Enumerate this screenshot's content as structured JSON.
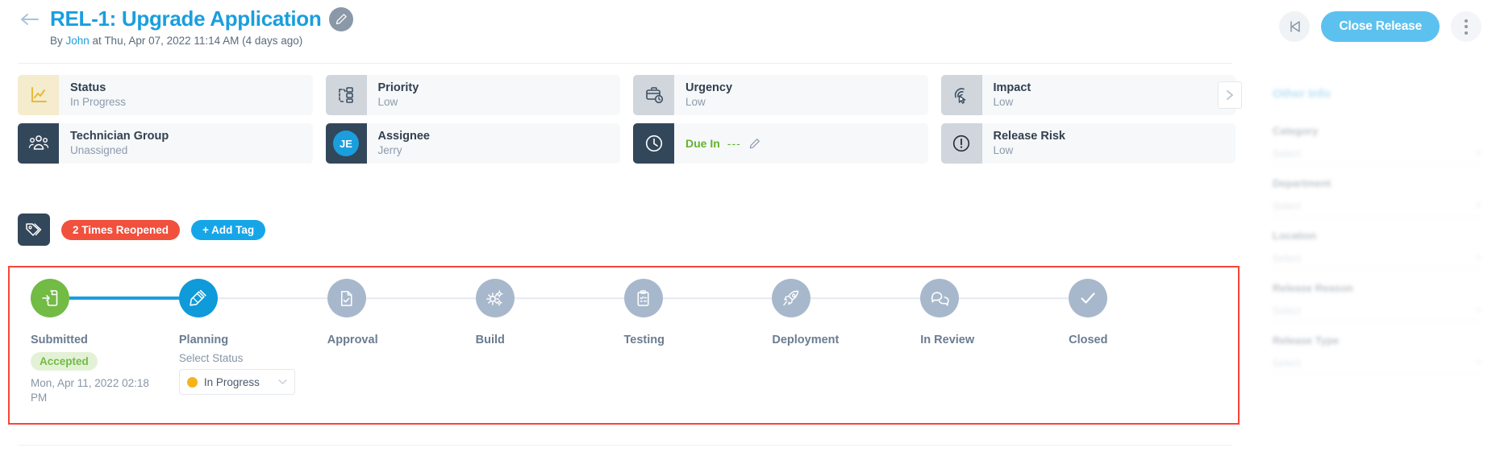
{
  "header": {
    "back_icon": "arrow-left-icon",
    "title": "REL-1: Upgrade Application",
    "edit_icon": "pencil-icon",
    "subtitle_prefix": "By ",
    "subtitle_author": "John",
    "subtitle_rest": " at Thu, Apr 07, 2022 11:14 AM (4 days ago)",
    "prev_icon": "skip-back-icon",
    "close_release_label": "Close Release",
    "more_icon": "kebab-menu-icon",
    "accent_blue": "#16a6e8"
  },
  "cards": {
    "next_icon": "chevron-right-icon",
    "row1": [
      {
        "label": "Status",
        "value": "In Progress",
        "icon": "line-chart-icon",
        "icon_bg": "yellow"
      },
      {
        "label": "Priority",
        "value": "Low",
        "icon": "priority-flow-icon",
        "icon_bg": "grey"
      },
      {
        "label": "Urgency",
        "value": "Low",
        "icon": "briefcase-clock-icon",
        "icon_bg": "grey"
      },
      {
        "label": "Impact",
        "value": "Low",
        "icon": "impact-target-icon",
        "icon_bg": "grey"
      }
    ],
    "row2": [
      {
        "label": "Technician Group",
        "value": "Unassigned",
        "icon": "people-group-icon",
        "icon_bg": "dark"
      },
      {
        "label": "Assignee",
        "value": "Jerry",
        "icon": "avatar-initials",
        "icon_bg": "dark",
        "initials": "JE"
      },
      {
        "label": "Due In",
        "value": "---",
        "icon": "clock-icon",
        "icon_bg": "dark",
        "edit_icon": "pencil-icon",
        "value_color": "#62b32e"
      },
      {
        "label": "Release Risk",
        "value": "Low",
        "icon": "alert-circle-icon",
        "icon_bg": "grey"
      }
    ]
  },
  "tags": {
    "tag_icon": "tags-icon",
    "items": [
      {
        "label": "2 Times Reopened",
        "color": "#f1503c"
      }
    ],
    "add_tag_label": "+ Add Tag"
  },
  "workflow": {
    "steps": [
      {
        "name": "Submitted",
        "icon": "file-import-icon",
        "state": "done",
        "badge": "Accepted",
        "date": "Mon, Apr 11, 2022 02:18 PM"
      },
      {
        "name": "Planning",
        "icon": "plan-edit-icon",
        "state": "current",
        "select_label": "Select Status",
        "select_value": "In Progress",
        "select_dot_color": "#f5b31c",
        "chevron": "chevron-down-icon"
      },
      {
        "name": "Approval",
        "icon": "file-check-icon",
        "state": "pending"
      },
      {
        "name": "Build",
        "icon": "gears-icon",
        "state": "pending"
      },
      {
        "name": "Testing",
        "icon": "clipboard-list-icon",
        "state": "pending"
      },
      {
        "name": "Deployment",
        "icon": "rocket-icon",
        "state": "pending"
      },
      {
        "name": "In Review",
        "icon": "chat-bubbles-icon",
        "state": "pending"
      },
      {
        "name": "Closed",
        "icon": "check-icon",
        "state": "pending"
      }
    ],
    "highlight_color": "#f8453a",
    "done_color": "#72bb45",
    "current_color": "#0f9ada",
    "pending_color": "#a8b8cc"
  },
  "right_panel": {
    "title": "Other Info",
    "fields": [
      {
        "label": "Category",
        "value": "Select"
      },
      {
        "label": "Department",
        "value": "Select"
      },
      {
        "label": "Location",
        "value": "Select"
      },
      {
        "label": "Release Reason",
        "value": "Select"
      },
      {
        "label": "Release Type",
        "value": "Select"
      }
    ]
  }
}
